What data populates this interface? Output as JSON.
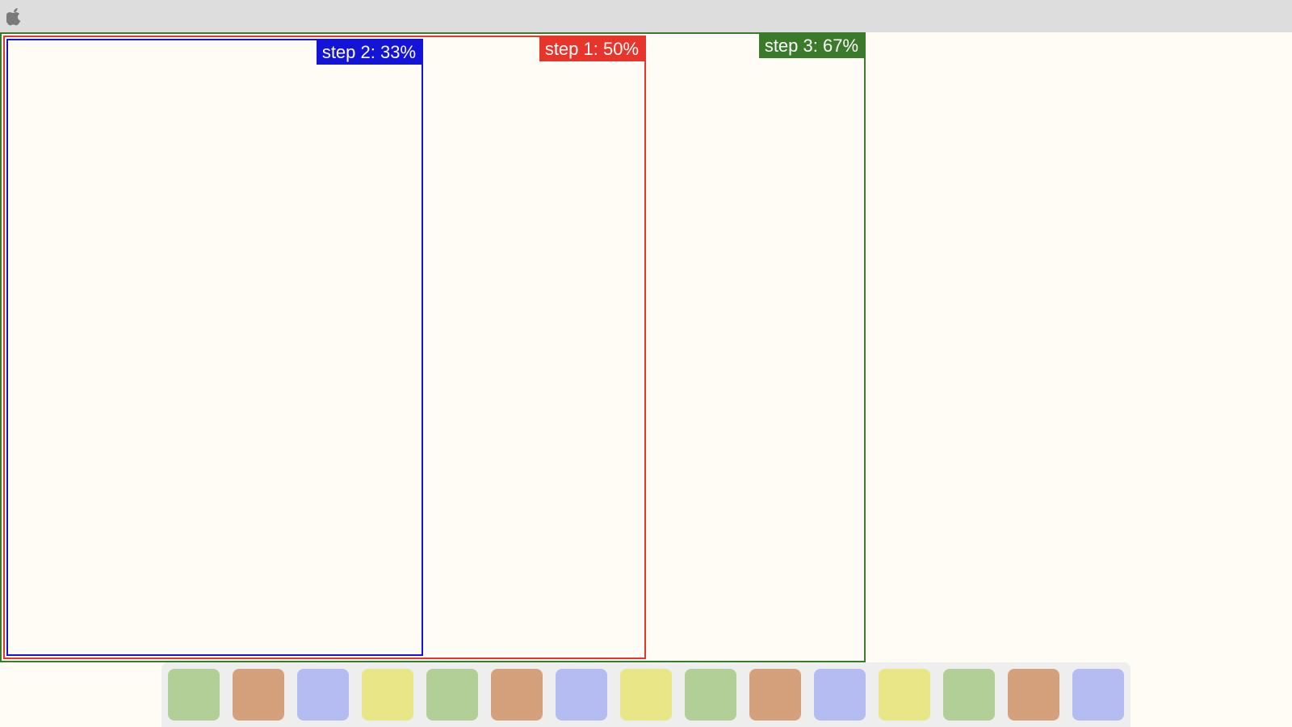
{
  "menubar": {
    "logo_icon": "apple-logo-icon"
  },
  "frames": {
    "step1": {
      "label": "step 1: 50%",
      "color": "#e8352b",
      "fraction": 0.5
    },
    "step2": {
      "label": "step 2: 33%",
      "color": "#1414d8",
      "fraction": 0.33
    },
    "step3": {
      "label": "step 3: 67%",
      "color": "#3a7a2a",
      "fraction": 0.67
    }
  },
  "dock": {
    "colors": {
      "green": "#b3cf98",
      "orange": "#d4a07c",
      "blue": "#b5bcf1",
      "yellow": "#e8e687"
    },
    "items": [
      "green",
      "orange",
      "blue",
      "yellow",
      "green",
      "orange",
      "blue",
      "yellow",
      "green",
      "orange",
      "blue",
      "yellow",
      "green",
      "orange",
      "blue"
    ]
  }
}
